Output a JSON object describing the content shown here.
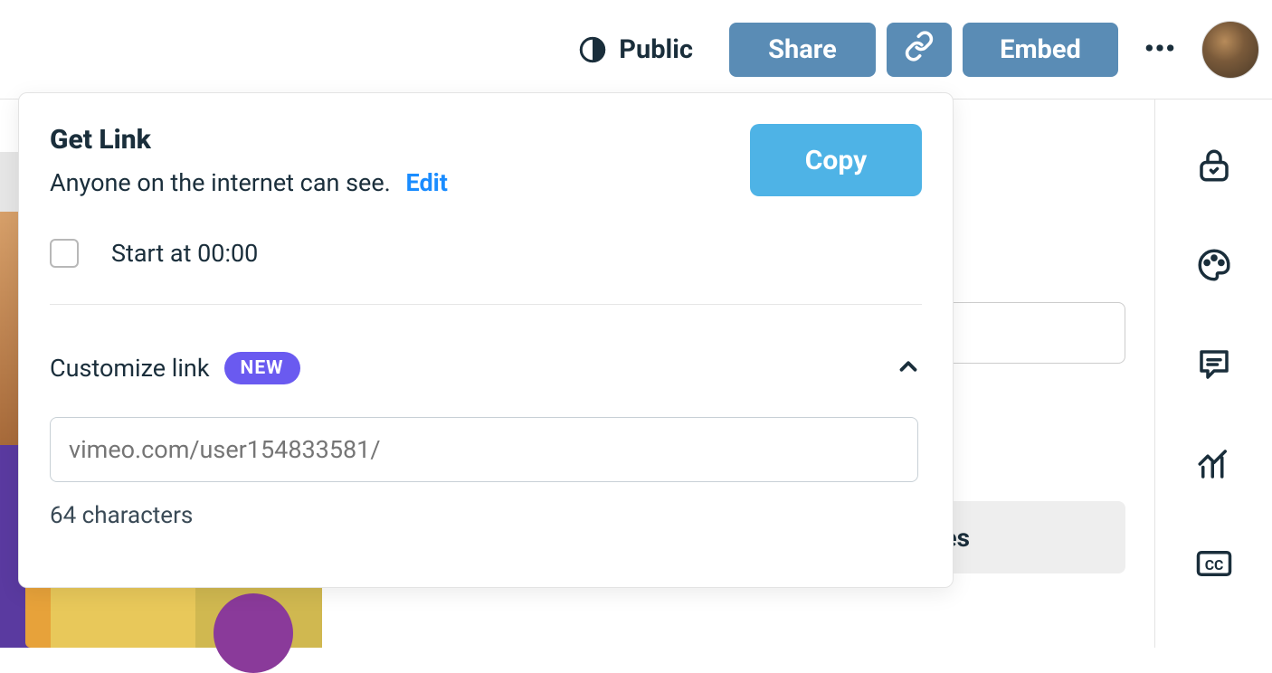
{
  "header": {
    "privacy_label": "Public",
    "share_label": "Share",
    "embed_label": "Embed"
  },
  "background": {
    "partial_button_text": "es"
  },
  "popup": {
    "title": "Get Link",
    "subtitle": "Anyone on the internet can see.",
    "edit_label": "Edit",
    "copy_label": "Copy",
    "start_at_label": "Start at 00:00",
    "customize_label": "Customize link",
    "badge_label": "NEW",
    "link_placeholder": "vimeo.com/user154833581/",
    "char_count_text": "64 characters"
  }
}
